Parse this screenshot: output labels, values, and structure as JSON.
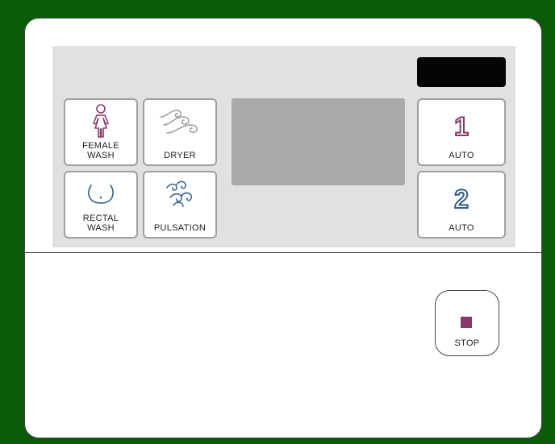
{
  "colors": {
    "background": "#0a5c0a",
    "female_accent": "#8a3a6a",
    "rectal_accent": "#2f5d8a",
    "dryer_accent": "#9a9a9a",
    "stop_accent": "#8a3a6a"
  },
  "buttons": {
    "female_wash": {
      "label_line1": "FEMALE",
      "label_line2": "WASH",
      "icon": "female-figure-icon"
    },
    "dryer": {
      "label": "DRYER",
      "icon": "air-swirl-icon"
    },
    "rectal_wash": {
      "label_line1": "RECTAL",
      "label_line2": "WASH",
      "icon": "rectal-icon"
    },
    "pulsation": {
      "label": "PULSATION",
      "icon": "pulse-swirl-icon"
    },
    "auto1": {
      "number": "1",
      "label": "AUTO"
    },
    "auto2": {
      "number": "2",
      "label": "AUTO"
    },
    "stop": {
      "label": "STOP",
      "icon": "stop-square-icon"
    }
  }
}
